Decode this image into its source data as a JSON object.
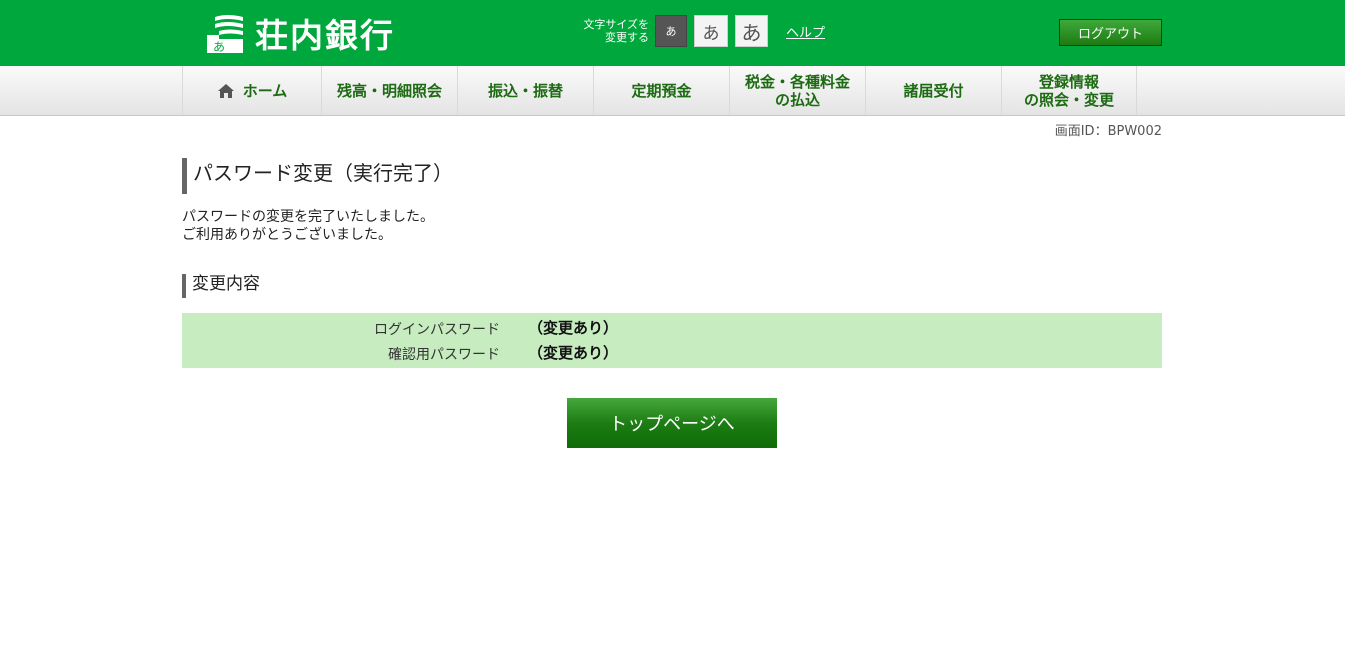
{
  "header": {
    "bank_name": "荘内銀行",
    "fontsize_label_line1": "文字サイズを",
    "fontsize_label_line2": "変更する",
    "font_sizes": [
      "あ",
      "あ",
      "あ"
    ],
    "help_label": "ヘルプ",
    "logout_label": "ログアウト"
  },
  "nav": {
    "home": "ホーム",
    "balance": "残高・明細照会",
    "transfer": "振込・振替",
    "deposit": "定期預金",
    "tax_line1": "税金・各種料金",
    "tax_line2": "の払込",
    "notification": "諸届受付",
    "registration_line1": "登録情報",
    "registration_line2": "の照会・変更"
  },
  "screen_id": "画面ID：BPW002",
  "main": {
    "title": "パスワード変更（実行完了）",
    "message_line1": "パスワードの変更を完了いたしました。",
    "message_line2": "ご利用ありがとうございました。",
    "section_title": "変更内容",
    "details": [
      {
        "label": "ログインパスワード",
        "value": "（変更あり）"
      },
      {
        "label": "確認用パスワード",
        "value": "（変更あり）"
      }
    ],
    "top_button": "トップページへ"
  },
  "colors": {
    "brand_green": "#00a73c",
    "nav_text": "#1d6b12",
    "detail_bg": "#c6ecc0"
  }
}
